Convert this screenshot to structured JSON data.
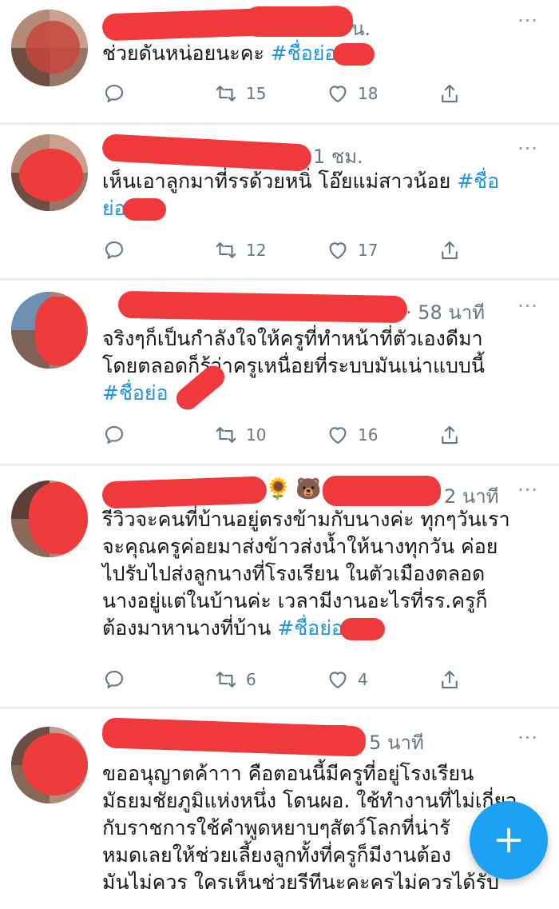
{
  "colors": {
    "accent": "#1da1f2",
    "hashtag": "#1b95e0",
    "redaction": "#f0393c",
    "meta_text": "#657786"
  },
  "more_label": "···",
  "tweets": [
    {
      "meta": "น.",
      "text_lines": [
        "ช่วยดันหน่อยนะคะ "
      ],
      "hashtag": "#ชื่อย่อ",
      "replies": "",
      "retweets": "15",
      "likes": "18"
    },
    {
      "meta": "1 ชม.",
      "text_lines": [
        "เห็นเอาลูกมาที่รรด้วยหนิ่ โอ๊ยแม่สาวน้อย "
      ],
      "hashtag_line1": "#ชื่อ",
      "hashtag_line2": "ย่อ",
      "replies": "",
      "retweets": "12",
      "likes": "17"
    },
    {
      "meta": "· 58 นาที",
      "text_lines": [
        "จริงๆก็เป็นกำลังใจให้ครูที่ทำหน้าที่ตัวเองดีมา",
        "โดยตลอดก็รู้ว่าครูเหนื่อยที่ระบบมันเน่าแบบนี้"
      ],
      "hashtag": "#ชื่อย่อ",
      "replies": "",
      "retweets": "10",
      "likes": "16"
    },
    {
      "meta": "2 นาที",
      "emoji_a": "🌻",
      "emoji_b": "🐻",
      "text_lines": [
        "รีวิวจะคนที่บ้านอยู่ตรงข้ามกับนางค่ะ ทุกๆวันเรา",
        "จะคุณครูค่อยมาส่งข้าวส่งน้ำให้นางทุกวัน ค่อย",
        "ไปรับไปส่งลูกนางที่โรงเรียน ในตัวเมืองตลอด",
        "นางอยู่แต่ในบ้านค่ะ เวลามีงานอะไรที่รร.ครูก็",
        "ต้องมาหานางที่บ้าน "
      ],
      "hashtag": "#ชื่อย่อ",
      "replies": "",
      "retweets": "6",
      "likes": "4"
    },
    {
      "meta": "5 · 5 นาที",
      "text_lines": [
        "ขออนุญาตค้าาา คือตอนนี้มีครูที่อยู่โรงเรียน",
        "มัธยมชัยภูมิแห่งหนึ่ง โดนผอ. ใช้ทำงานที่ไม่เกี่ยว",
        "กับราชการใช้คำพูดหยาบๆสัตว์โลกที่น่ารั",
        "หมดเลยให้ช่วยเลี้ยงลูกทั้งที่ครูก็มีงานต้อง",
        "มันไม่ควร ใครเห็นช่วยรีทีนะคะครไม่ควรได้รับ"
      ]
    }
  ]
}
